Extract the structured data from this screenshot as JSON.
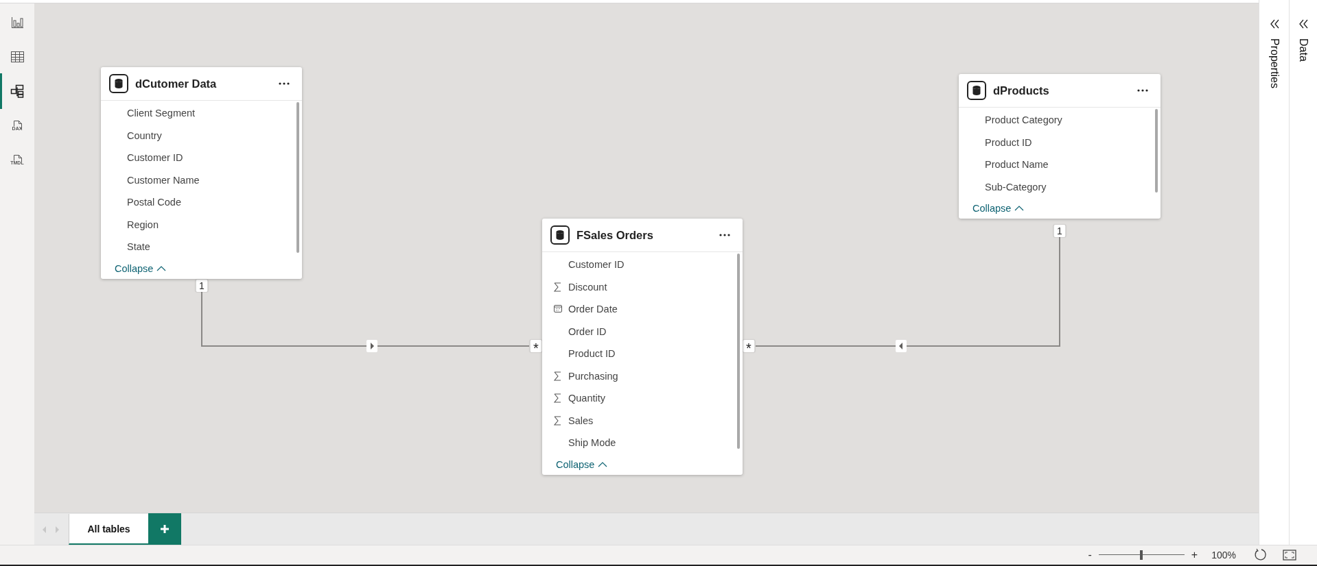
{
  "views": [
    {
      "kind": "report",
      "selected": false
    },
    {
      "kind": "table",
      "selected": false
    },
    {
      "kind": "model",
      "selected": true
    },
    {
      "kind": "dax",
      "label": "DAX",
      "selected": false
    },
    {
      "kind": "tmdl",
      "label": "TMDL",
      "selected": false
    }
  ],
  "tables": [
    {
      "name": "dCutomer Data",
      "collapse_label": "Collapse",
      "fields": [
        {
          "name": "Client Segment",
          "kind": "text"
        },
        {
          "name": "Country",
          "kind": "text"
        },
        {
          "name": "Customer ID",
          "kind": "text"
        },
        {
          "name": "Customer Name",
          "kind": "text"
        },
        {
          "name": "Postal Code",
          "kind": "text"
        },
        {
          "name": "Region",
          "kind": "text"
        },
        {
          "name": "State",
          "kind": "text"
        }
      ]
    },
    {
      "name": "FSales Orders",
      "collapse_label": "Collapse",
      "fields": [
        {
          "name": "Customer ID",
          "kind": "text"
        },
        {
          "name": "Discount",
          "kind": "sum"
        },
        {
          "name": "Order Date",
          "kind": "date"
        },
        {
          "name": "Order ID",
          "kind": "text"
        },
        {
          "name": "Product ID",
          "kind": "text"
        },
        {
          "name": "Purchasing",
          "kind": "sum"
        },
        {
          "name": "Quantity",
          "kind": "sum"
        },
        {
          "name": "Sales",
          "kind": "sum"
        },
        {
          "name": "Ship Mode",
          "kind": "text"
        }
      ]
    },
    {
      "name": "dProducts",
      "collapse_label": "Collapse",
      "fields": [
        {
          "name": "Product Category",
          "kind": "text"
        },
        {
          "name": "Product ID",
          "kind": "text"
        },
        {
          "name": "Product Name",
          "kind": "text"
        },
        {
          "name": "Sub-Category",
          "kind": "text"
        }
      ]
    }
  ],
  "relationships": [
    {
      "one_label": "1",
      "many_label": "*",
      "kind": "rightward"
    },
    {
      "one_label": "1",
      "many_label": "*",
      "kind": "leftward"
    }
  ],
  "layout_tabs": [
    {
      "label": "All tables",
      "selected": true
    }
  ],
  "panes": [
    {
      "title": "Properties"
    },
    {
      "title": "Data"
    }
  ],
  "status_bar": {
    "zoom_out": "-",
    "zoom_in": "+",
    "zoom_level": "100%",
    "zoom": {
      "level": 0.5
    }
  }
}
